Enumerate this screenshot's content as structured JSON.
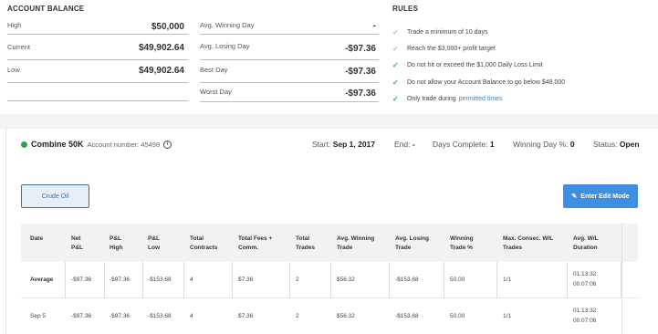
{
  "account_balance": {
    "title": "ACCOUNT BALANCE",
    "rows": [
      {
        "label": "High",
        "value": "$50,000"
      },
      {
        "label": "Current",
        "value": "$49,902.64"
      },
      {
        "label": "Low",
        "value": "$49,902.64"
      }
    ]
  },
  "stats": [
    {
      "label": "Avg. Winning Day",
      "value": "-"
    },
    {
      "label": "Avg. Losing Day",
      "value": "-$97.36"
    },
    {
      "label": "Best Day",
      "value": "-$97.36"
    },
    {
      "label": "Worst Day",
      "value": "-$97.36"
    }
  ],
  "rules": {
    "title": "RULES",
    "items": [
      {
        "text": "Trade a minimum of 10 days",
        "status": "pending"
      },
      {
        "text": "Reach the $3,000+ profit target",
        "status": "pending"
      },
      {
        "text": "Do not hit or exceed the $1,000 Daily Loss Limit",
        "status": "done"
      },
      {
        "text": "Do not allow your Account Balance to go below $48,000",
        "status": "done"
      },
      {
        "text": "Only trade during",
        "status": "done",
        "link": "permitted times"
      }
    ]
  },
  "account": {
    "name": "Combine 50K",
    "number_label": "Account number: 45498",
    "start_label": "Start:",
    "start_value": "Sep 1, 2017",
    "end_label": "End:",
    "end_value": "-",
    "days_label": "Days Complete:",
    "days_value": "1",
    "winning_label": "Winning Day %:",
    "winning_value": "0",
    "status_label": "Status:",
    "status_value": "Open",
    "status_color": "#2ea44f"
  },
  "buttons": {
    "crude": "Crude Oil",
    "edit": "Enter Edit Mode"
  },
  "table": {
    "headers": [
      [
        "Date"
      ],
      [
        "Net",
        "P&L"
      ],
      [
        "P&L",
        "High"
      ],
      [
        "P&L",
        "Low"
      ],
      [
        "Total",
        "Contracts"
      ],
      [
        "Total Fees +",
        "Comm."
      ],
      [
        "Total",
        "Trades"
      ],
      [
        "Avg. Winning",
        "Trade"
      ],
      [
        "Avg. Losing",
        "Trade"
      ],
      [
        "Winning",
        "Trade %"
      ],
      [
        "Max. Consec. W/L",
        "Trades"
      ],
      [
        "Avg. W/L",
        "Duration"
      ]
    ],
    "rows": [
      [
        "Average",
        "-$97.36",
        "-$97.36",
        "-$153.68",
        "4",
        "$7.36",
        "2",
        "$56.32",
        "-$153.68",
        "50.00",
        "1/1",
        "01:13:32",
        "00:07:06"
      ],
      [
        "Sep 5",
        "-$97.36",
        "-$97.36",
        "-$153.68",
        "4",
        "$7.36",
        "2",
        "$56.32",
        "-$153.68",
        "50.00",
        "1/1",
        "01:13:32",
        "00:07:06"
      ]
    ]
  }
}
